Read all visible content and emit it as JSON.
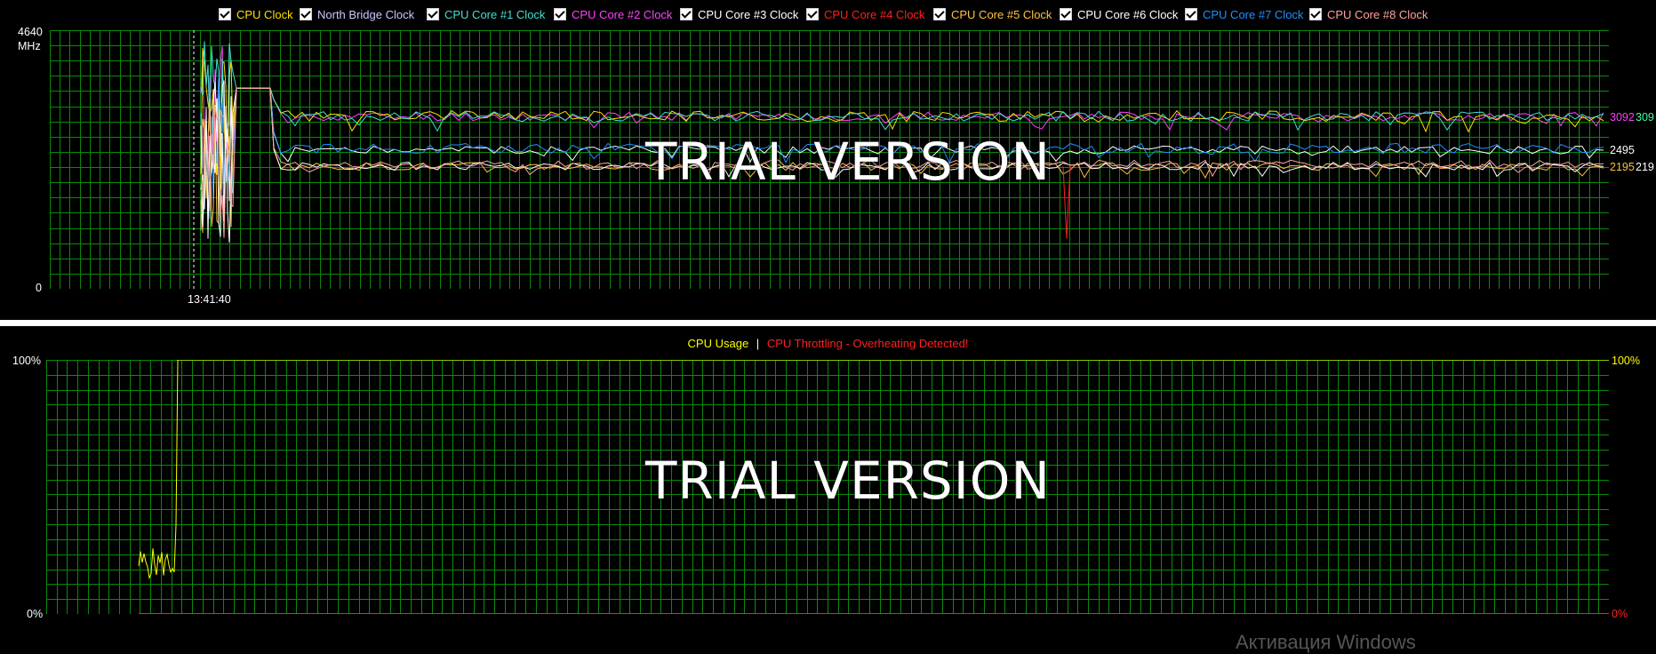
{
  "clock_panel": {
    "legend": [
      {
        "label": "CPU Clock",
        "color": "#ffe000",
        "checked": true
      },
      {
        "label": "North Bridge Clock",
        "color": "#c8c8ff",
        "checked": true
      },
      {
        "label": "CPU Core #1 Clock",
        "color": "#40e0d0",
        "checked": true
      },
      {
        "label": "CPU Core #2 Clock",
        "color": "#ff40ff",
        "checked": true
      },
      {
        "label": "CPU Core #3 Clock",
        "color": "#ffffff",
        "checked": true
      },
      {
        "label": "CPU Core #4 Clock",
        "color": "#ff2020",
        "checked": true
      },
      {
        "label": "CPU Core #5 Clock",
        "color": "#ffc040",
        "checked": true
      },
      {
        "label": "CPU Core #6 Clock",
        "color": "#ffffff",
        "checked": true
      },
      {
        "label": "CPU Core #7 Clock",
        "color": "#2090ff",
        "checked": true
      },
      {
        "label": "CPU Core #8 Clock",
        "color": "#ffa0a0",
        "checked": true
      }
    ],
    "y_max_label": "4640",
    "y_unit": "MHz",
    "y_min_label": "0",
    "time_label": "13:41:40",
    "watermark": "TRIAL VERSION",
    "right_values": [
      {
        "text": "3092",
        "color": "#ff40ff"
      },
      {
        "text": "309",
        "color": "#40ffa0"
      },
      {
        "text": "2495",
        "color": "#ffffff"
      },
      {
        "text": "2195",
        "color": "#ffc040"
      },
      {
        "text": "219",
        "color": "#ffffff"
      }
    ]
  },
  "usage_panel": {
    "legend_usage": "CPU Usage",
    "legend_sep": "|",
    "legend_throttle": "CPU Throttling - Overheating Detected!",
    "usage_color": "#ffff00",
    "throttle_color": "#ff2020",
    "y_max_left": "100%",
    "y_min_left": "0%",
    "y_max_right": "100%",
    "y_min_right": "0%",
    "watermark": "TRIAL VERSION"
  },
  "overlay": {
    "activate_text": "Активация Windows"
  },
  "grid_color": "#0a8a0a",
  "chart_data": [
    {
      "type": "line",
      "ylabel": "MHz",
      "ylim": [
        0,
        4640
      ],
      "series": [
        {
          "name": "CPU Core #2 Clock",
          "final_value": 3092
        },
        {
          "name": "CPU Core #1 Clock",
          "final_value": 2495
        },
        {
          "name": "CPU Clock",
          "final_value": 2195
        }
      ]
    },
    {
      "type": "line",
      "ylabel": "%",
      "ylim": [
        0,
        100
      ],
      "series": [
        {
          "name": "CPU Usage",
          "final_value": 100
        },
        {
          "name": "CPU Throttling - Overheating Detected!",
          "final_value": 0
        }
      ]
    }
  ]
}
